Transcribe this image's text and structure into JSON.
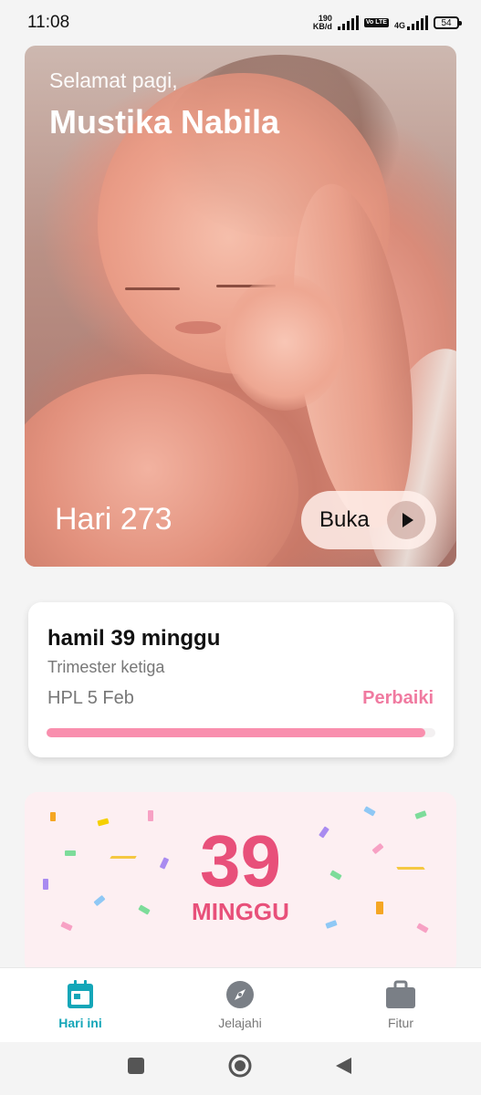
{
  "status_bar": {
    "time": "11:08",
    "net_speed_value": "190",
    "net_speed_unit": "KB/d",
    "volte": "Vo LTE",
    "network": "4G",
    "battery": "54"
  },
  "hero": {
    "greeting": "Selamat pagi,",
    "user_name": "Mustika Nabila",
    "day_label": "Hari 273",
    "open_button": "Buka"
  },
  "pregnancy": {
    "week_text": "hamil 39 minggu",
    "trimester": "Trimester ketiga",
    "due_date": "HPL 5 Feb",
    "fix_link": "Perbaiki",
    "progress_fraction": 0.975
  },
  "week_card": {
    "number": "39",
    "unit": "MINGGU"
  },
  "bottom_nav": {
    "items": [
      {
        "label": "Hari ini",
        "icon": "calendar-icon",
        "active": true
      },
      {
        "label": "Jelajahi",
        "icon": "compass-icon",
        "active": false
      },
      {
        "label": "Fitur",
        "icon": "briefcase-icon",
        "active": false
      }
    ]
  },
  "colors": {
    "accent": "#14a6b8",
    "pink": "#e8507a",
    "progress": "#f98fae"
  }
}
